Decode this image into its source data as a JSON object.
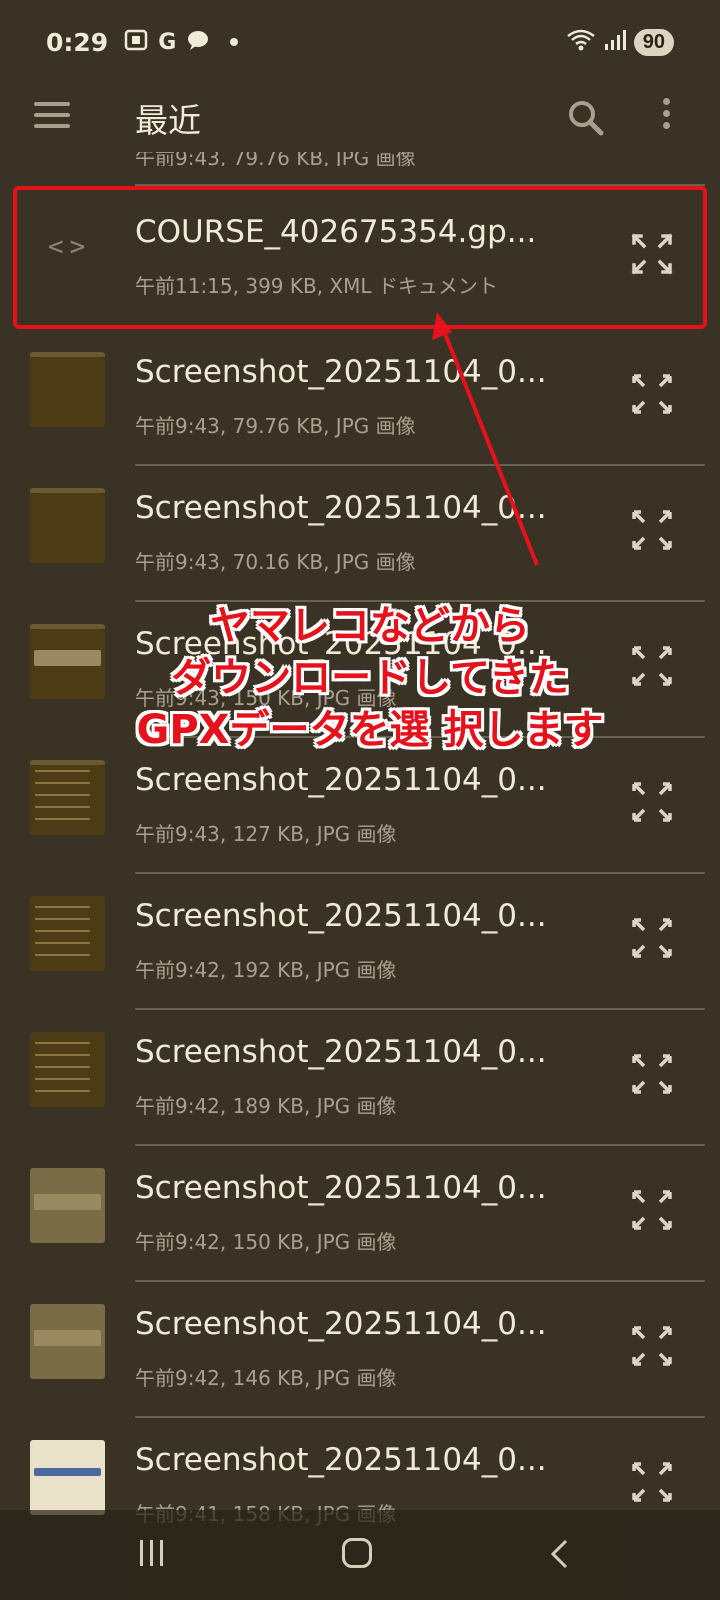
{
  "status": {
    "time": "0:29",
    "left_icons": [
      "screenshot-icon",
      "google-icon",
      "chat-icon"
    ],
    "battery": "90"
  },
  "appbar": {
    "title": "最近"
  },
  "partial_row": {
    "meta": "午前9:43, 79.76 KB, JPG 画像"
  },
  "files": [
    {
      "name": "COURSE_402675354.gp...",
      "meta": "午前11:15, 399 KB, XML ドキュメント",
      "icon": "code-icon"
    },
    {
      "name": "Screenshot_20251104_0...",
      "meta": "午前9:43, 79.76 KB, JPG 画像"
    },
    {
      "name": "Screenshot_20251104_0...",
      "meta": "午前9:43, 70.16 KB, JPG 画像"
    },
    {
      "name": "Screenshot_20251104_0...",
      "meta": "午前9:43, 150 KB, JPG 画像"
    },
    {
      "name": "Screenshot_20251104_0...",
      "meta": "午前9:43, 127 KB, JPG 画像"
    },
    {
      "name": "Screenshot_20251104_0...",
      "meta": "午前9:42, 192 KB, JPG 画像"
    },
    {
      "name": "Screenshot_20251104_0...",
      "meta": "午前9:42, 189 KB, JPG 画像"
    },
    {
      "name": "Screenshot_20251104_0...",
      "meta": "午前9:42, 150 KB, JPG 画像"
    },
    {
      "name": "Screenshot_20251104_0...",
      "meta": "午前9:42, 146 KB, JPG 画像"
    },
    {
      "name": "Screenshot_20251104_0...",
      "meta": "午前9:41, 158 KB, JPG 画像"
    }
  ],
  "annotation": {
    "line1": "ヤマレコなどから",
    "line2": "ダウンロードしてきた",
    "line3": "GPXデータを選 択します",
    "color": "#e5121c"
  },
  "colors": {
    "background": "#3a3225",
    "highlight": "#e5121c"
  }
}
